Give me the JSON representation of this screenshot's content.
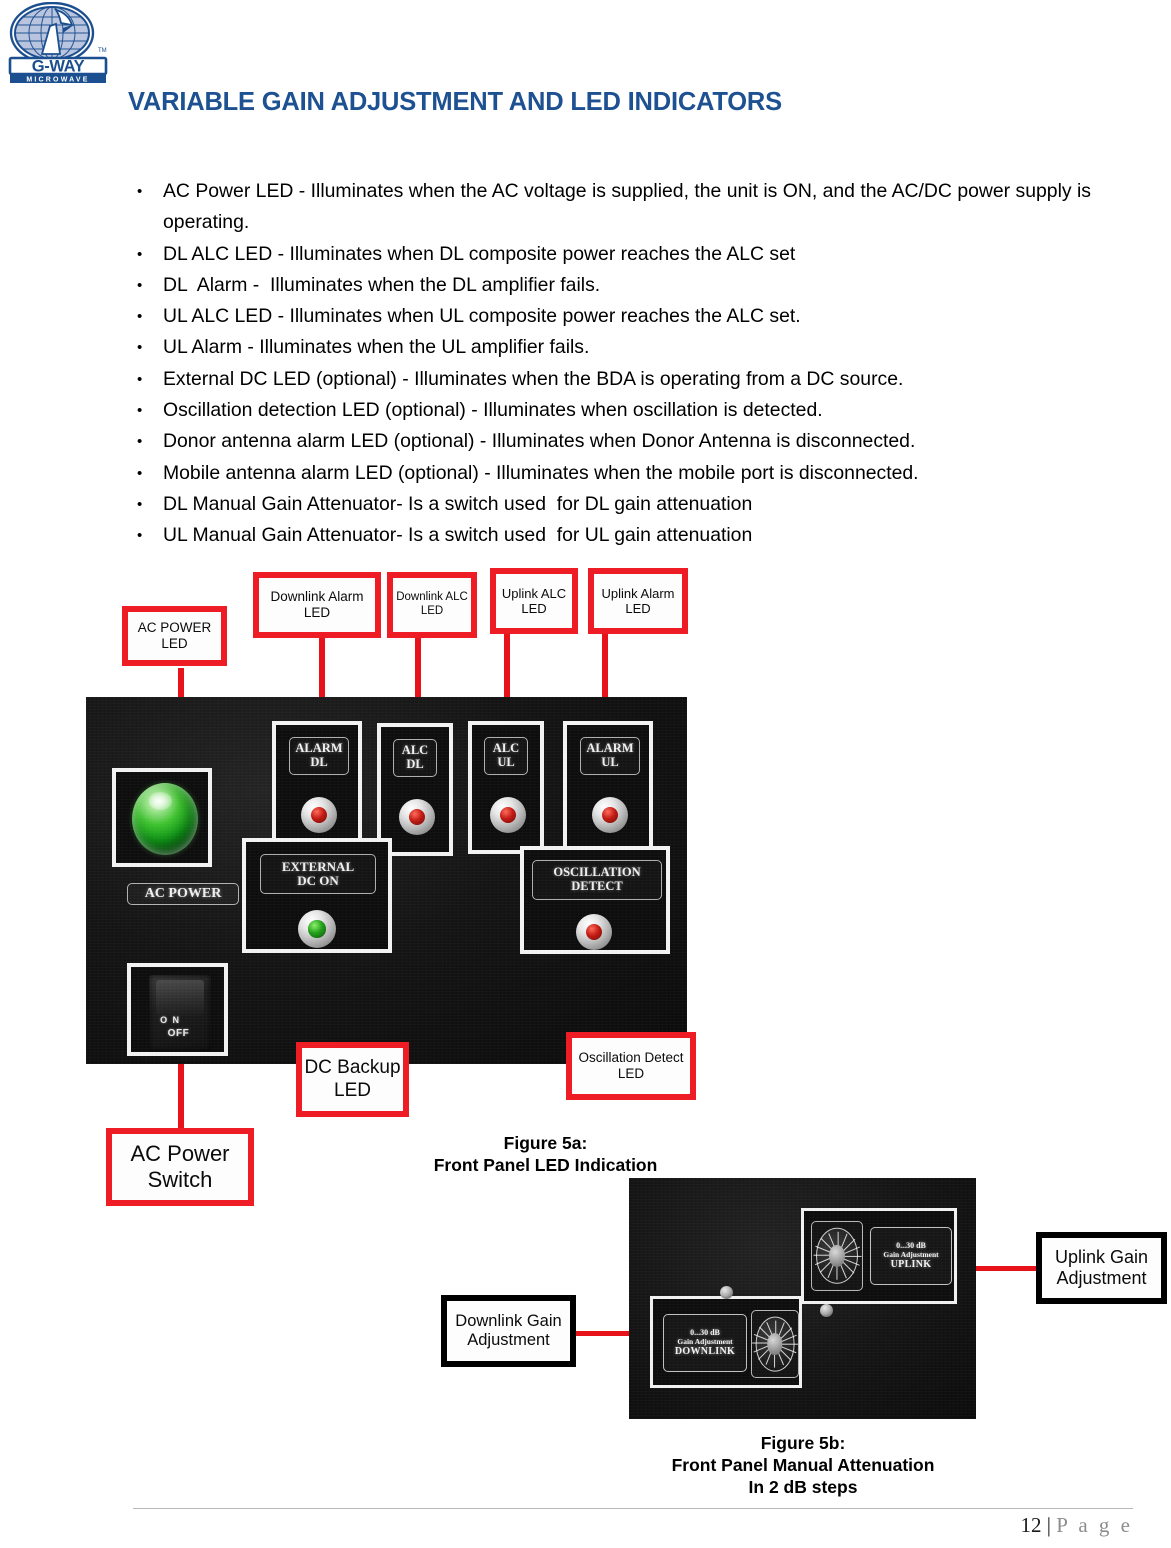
{
  "logo": {
    "brand": "G-WAY",
    "sub_brand": "MICROWAVE",
    "tm": "TM",
    "colors": {
      "primary": "#1c4f8f",
      "globe_fill": "#b9c4de"
    }
  },
  "title": "VARIABLE GAIN ADJUSTMENT AND LED INDICATORS",
  "title_color": "#1d5192",
  "bullets": [
    "AC Power LED - Illuminates when the AC voltage is supplied, the unit is ON, and the AC/DC power supply is operating.",
    "DL ALC LED - Illuminates when DL composite power reaches the ALC set",
    "DL  Alarm -  Illuminates when the DL amplifier fails.",
    "UL ALC LED - Illuminates when UL composite power reaches the ALC set.",
    "UL Alarm - Illuminates when the UL amplifier fails.",
    "External DC LED (optional) - Illuminates when the BDA is operating from a DC source.",
    "Oscillation detection LED (optional) - Illuminates when oscillation is detected.",
    "Donor antenna alarm LED (optional) - Illuminates when Donor Antenna is disconnected.",
    "Mobile antenna alarm LED (optional) - Illuminates when the mobile port is disconnected.",
    "DL Manual Gain Attenuator- Is a switch used  for DL gain attenuation",
    "UL Manual Gain Attenuator- Is a switch used  for UL gain attenuation"
  ],
  "figure_5a": {
    "callouts": {
      "ac_power_led": "AC POWER\nLED",
      "downlink_alarm_led": "Downlink Alarm\nLED",
      "downlink_alc_led": "Downlink ALC\nLED",
      "uplink_alc_led": "Uplink ALC\nLED",
      "uplink_alarm_led": "Uplink Alarm\nLED",
      "dc_backup_led": "DC Backup\nLED",
      "oscillation_detect_led": "Oscillation Detect\nLED",
      "ac_power_switch": "AC Power\nSwitch"
    },
    "panel_labels": {
      "ac_power": "AC POWER",
      "alarm_dl": "ALARM\nDL",
      "alc_dl": "ALC\nDL",
      "alc_ul": "ALC\nUL",
      "alarm_ul": "ALARM\nUL",
      "external_dc_on": "EXTERNAL\nDC ON",
      "oscillation_detect": "OSCILLATION\nDETECT"
    },
    "switch": {
      "on": "O N",
      "off": "OFF"
    },
    "led_states": {
      "ac_power": "green",
      "alarm_dl": "red",
      "alc_dl": "red",
      "alc_ul": "red",
      "alarm_ul": "red",
      "external_dc_on": "green",
      "oscillation_detect": "red"
    },
    "caption_line1": "Figure 5a:",
    "caption_line2": "Front Panel LED Indication"
  },
  "figure_5b": {
    "callouts": {
      "downlink_gain": "Downlink Gain\nAdjustment",
      "uplink_gain": "Uplink Gain\nAdjustment"
    },
    "plates": {
      "downlink": {
        "range": "0...30 dB",
        "function": "Gain Adjustment",
        "path": "DOWNLINK"
      },
      "uplink": {
        "range": "0...30 dB",
        "function": "Gain Adjustment",
        "path": "UPLINK"
      }
    },
    "caption_line1": "Figure 5b:",
    "caption_line2": "Front Panel Manual Attenuation",
    "caption_line3": "In 2 dB steps"
  },
  "footer": {
    "page_number": "12",
    "separator": " | ",
    "page_word": "P a g e"
  }
}
